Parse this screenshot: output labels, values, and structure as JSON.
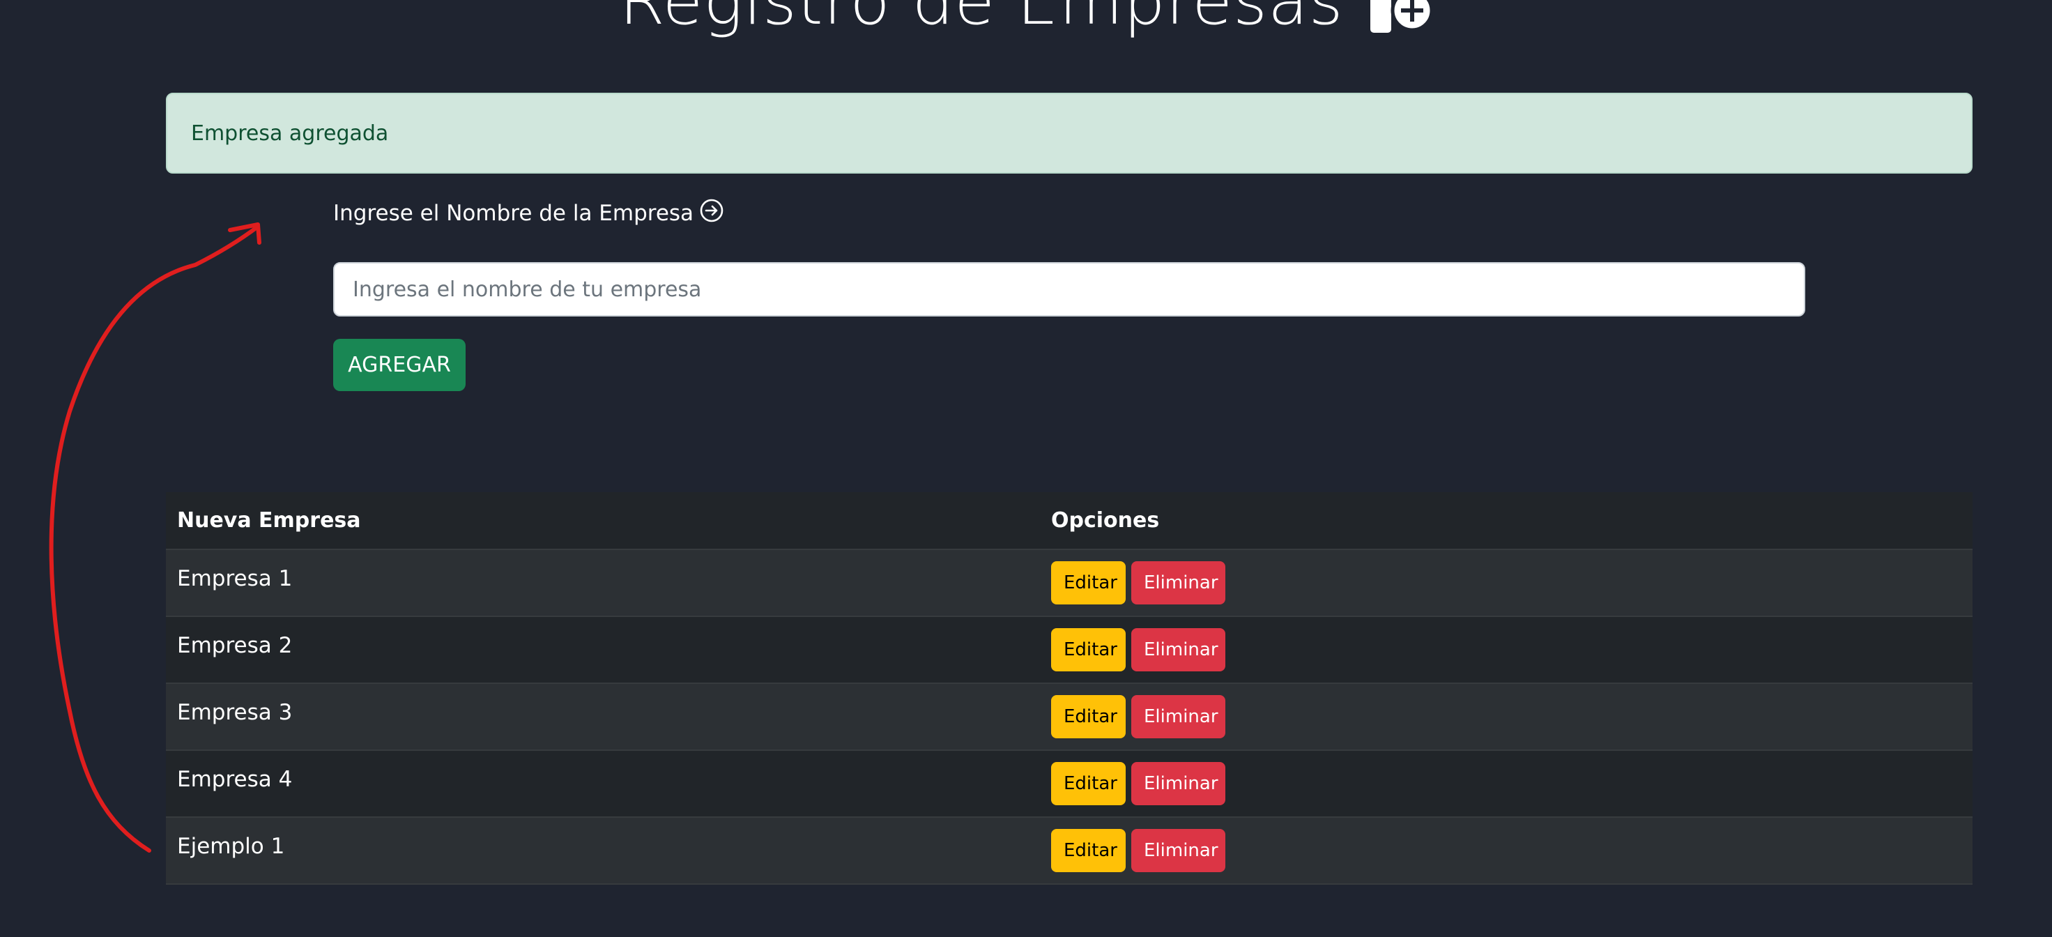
{
  "header": {
    "title": "Registro de Empresas",
    "title_icon": "building-add-icon"
  },
  "alert": {
    "text": "Empresa agregada",
    "color": "#d1e7dd"
  },
  "form": {
    "label": "Ingrese el Nombre de la Empresa",
    "label_icon": "arrow-right-circle-icon",
    "input_value": "",
    "input_placeholder": "Ingresa el nombre de tu empresa",
    "submit_label": "AGREGAR",
    "submit_color": "#198754"
  },
  "table": {
    "columns": [
      "Nueva Empresa",
      "Opciones"
    ],
    "rows": [
      {
        "name": "Empresa 1",
        "edit_label": "Editar",
        "delete_label": "Eliminar"
      },
      {
        "name": "Empresa 2",
        "edit_label": "Editar",
        "delete_label": "Eliminar"
      },
      {
        "name": "Empresa 3",
        "edit_label": "Editar",
        "delete_label": "Eliminar"
      },
      {
        "name": "Empresa 4",
        "edit_label": "Editar",
        "delete_label": "Eliminar"
      },
      {
        "name": "Ejemplo 1",
        "edit_label": "Editar",
        "delete_label": "Eliminar"
      }
    ],
    "edit_color": "#ffc107",
    "delete_color": "#dc3545"
  },
  "annotation": {
    "type": "hand-drawn-arrow",
    "color": "#e01e1e"
  }
}
